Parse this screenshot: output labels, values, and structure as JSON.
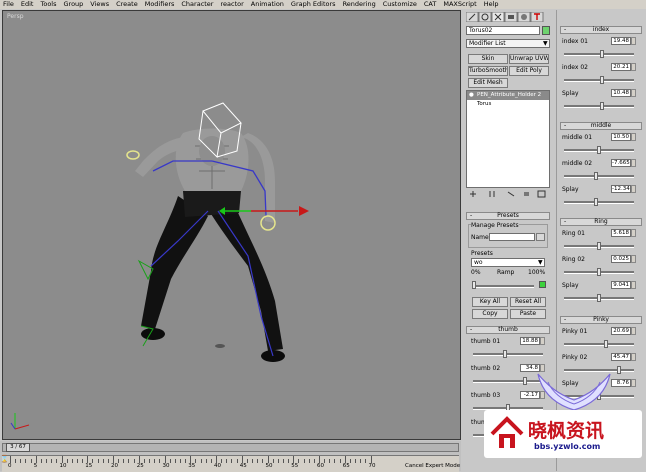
{
  "menu": [
    "File",
    "Edit",
    "Tools",
    "Group",
    "Views",
    "Create",
    "Modifiers",
    "Character",
    "reactor",
    "Animation",
    "Graph Editors",
    "Rendering",
    "Customize",
    "CAT",
    "MAXScript",
    "Help"
  ],
  "viewport": {
    "label": "Persp"
  },
  "command_panel": {
    "object_name": "Torus02",
    "modifier_list": "Modifier List",
    "buttons": [
      "Skin",
      "Unwrap UVW",
      "TurboSmooth",
      "Edit Poly",
      "Edit Mesh"
    ],
    "stack": [
      "PEN_Attribute_Holder 2",
      "Torus"
    ],
    "presets": {
      "title": "Presets",
      "manage": "Manage Presets",
      "name_label": "Name:",
      "presets_label": "Presets",
      "preset_value": "wo",
      "pct0": "0%",
      "ramp": "Ramp",
      "pct100": "100%",
      "key_all": "Key All",
      "reset_all": "Reset All",
      "copy": "Copy",
      "paste": "Paste"
    },
    "thumb": {
      "title": "thumb",
      "rows": [
        {
          "label": "thumb 01",
          "value": "18.88",
          "level": 0.45
        },
        {
          "label": "thumb 02",
          "value": "34.8",
          "level": 0.75
        },
        {
          "label": "thumb 03",
          "value": "-2.17",
          "level": 0.5
        },
        {
          "label": "thumb",
          "value": "",
          "level": 0.5
        }
      ]
    }
  },
  "fingers": {
    "index": {
      "title": "index",
      "rows": [
        {
          "label": "index 01",
          "value": "19.48",
          "level": 0.55
        },
        {
          "label": "index 02",
          "value": "20.21",
          "level": 0.55
        },
        {
          "label": "Splay",
          "value": "10.48",
          "level": 0.55
        }
      ]
    },
    "middle": {
      "title": "middle",
      "rows": [
        {
          "label": "middle 01",
          "value": "10.50",
          "level": 0.5
        },
        {
          "label": "middle 02",
          "value": "-7.665",
          "level": 0.45
        },
        {
          "label": "Splay",
          "value": "-12.34",
          "level": 0.45
        }
      ]
    },
    "ring": {
      "title": "Ring",
      "rows": [
        {
          "label": "Ring 01",
          "value": "5.618",
          "level": 0.5
        },
        {
          "label": "Ring 02",
          "value": "0.025",
          "level": 0.5
        },
        {
          "label": "Splay",
          "value": "9.041",
          "level": 0.5
        }
      ]
    },
    "pinky": {
      "title": "Pinky",
      "rows": [
        {
          "label": "Pinky 01",
          "value": "20.69",
          "level": 0.6
        },
        {
          "label": "Pinky 02",
          "value": "45.47",
          "level": 0.8
        },
        {
          "label": "Splay",
          "value": "8.76",
          "level": 0.5
        }
      ]
    }
  },
  "timeline": {
    "frame": "3 / 67",
    "ticks": [
      "0",
      "5",
      "10",
      "15",
      "20",
      "25",
      "30",
      "35",
      "40",
      "45",
      "50",
      "55",
      "60",
      "65",
      "70"
    ],
    "status": "Cancel Expert Mode"
  },
  "watermark": {
    "brand": "晓枫资讯",
    "url": "bbs.yzwlo.com"
  },
  "colors": {
    "viewport": "#8c8c8c",
    "selection_yellow": "#e6e68c",
    "brand_red": "#c8141e"
  }
}
